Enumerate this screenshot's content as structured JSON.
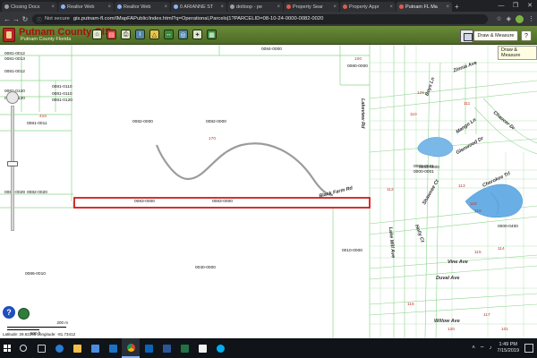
{
  "browser": {
    "tabs": [
      {
        "title": "Closing Docs",
        "active": false,
        "favicon": "doc"
      },
      {
        "title": "Realtor Web",
        "active": false,
        "favicon": "blue"
      },
      {
        "title": "Realtor Web",
        "active": false,
        "favicon": "blue"
      },
      {
        "title": "0 ARIANNE ST",
        "active": false,
        "favicon": "blue"
      },
      {
        "title": "dotloop - pe",
        "active": false,
        "favicon": "gray"
      },
      {
        "title": "Property Sear",
        "active": false,
        "favicon": "red"
      },
      {
        "title": "Property Appr",
        "active": false,
        "favicon": "red"
      },
      {
        "title": "Putnam FL Ma",
        "active": true,
        "favicon": "red"
      }
    ],
    "url_prefix": "Not secure",
    "url": "gis.putnam-fl.com/IMapFAPublic/index.html?q=Operational,Parcels|1?PARCELID=08-10-24-0000-0082-0020"
  },
  "gis": {
    "title": "Putnam County GIS",
    "subtitle": "Putnam County Florida",
    "draw_button": "Draw & Measure",
    "help_button": "?",
    "tooltip": "Draw & Measure"
  },
  "map": {
    "parcels": [
      {
        "label": "0081-0012",
        "row": 0
      },
      {
        "label": "0081-0013",
        "row": 0
      },
      {
        "label": "0081-0012",
        "row": 0
      },
      {
        "label": "0081-0120",
        "row": 0
      },
      {
        "label": "0081-0110",
        "row": 0
      },
      {
        "label": "0081-0120",
        "row": 0
      },
      {
        "label": "0081-0110",
        "row": 0
      },
      {
        "label": "0081-0120",
        "row": 0
      },
      {
        "label": "0081-0011",
        "row": 0
      },
      {
        "label": "0082-0000",
        "row": 0
      },
      {
        "label": "0084-0000",
        "row": 0
      },
      {
        "label": "0080-0000",
        "row": 0
      },
      {
        "label": "0082-0000",
        "row": 0
      },
      {
        "label": "0083-0000",
        "row": 0
      },
      {
        "label": "0000-0031",
        "row": 0
      },
      {
        "label": "0000-0001",
        "row": 0
      },
      {
        "label": "0082-0029",
        "row": 0
      },
      {
        "label": "0082-0020",
        "row": 0
      },
      {
        "label": "0083-0000",
        "row": 0
      },
      {
        "label": "0083-0000",
        "row": 0
      },
      {
        "label": "0086-0010",
        "row": 0
      },
      {
        "label": "0030-0000",
        "row": 0
      },
      {
        "label": "0010-0000",
        "row": 0
      },
      {
        "label": "0000-0400",
        "row": 0
      }
    ],
    "red_labels": [
      "410",
      "170",
      "100",
      "125",
      "110",
      "111",
      "112",
      "113",
      "118",
      "119",
      "115",
      "114",
      "116",
      "117",
      "120",
      "101"
    ],
    "roads": [
      "Lakeview Rd",
      "Black Farm Rd",
      "Boys Ln",
      "Zinnia Ave",
      "Chaucer Dr",
      "Mango Ln",
      "Glenwood Dr",
      "Holly Ct",
      "Cherokee Trl",
      "Shawnee Ct",
      "Lake Mill Ave",
      "Vine Ave",
      "Duval Ave",
      "Willow Ave"
    ],
    "scale_metric": "200 m",
    "scale_imperial": "500 ft",
    "coordinates": "Latitude: 29.62295  Longitude: -81.73412"
  },
  "taskbar": {
    "time": "1:49 PM",
    "date": "7/15/2019"
  }
}
